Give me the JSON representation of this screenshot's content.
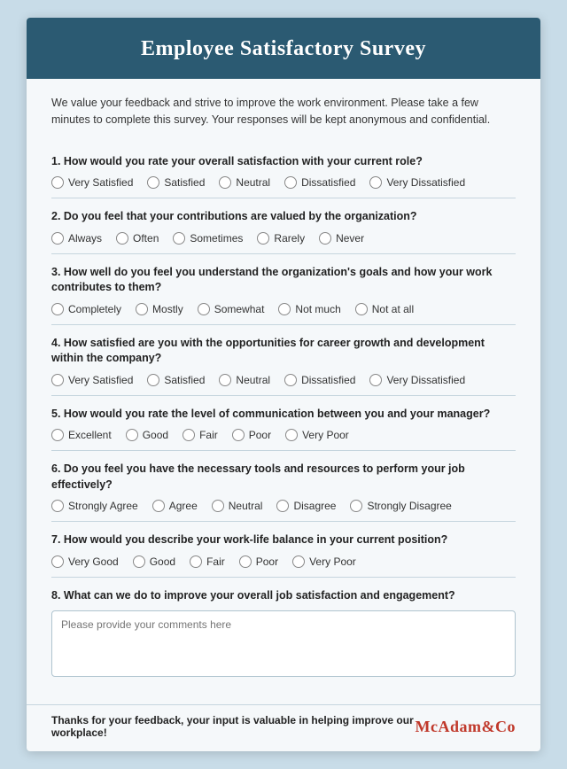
{
  "header": {
    "title": "Employee Satisfactory Survey"
  },
  "intro": "We value your feedback and strive to improve the work environment. Please take a few minutes to complete this survey. Your responses will be kept anonymous and confidential.",
  "questions": [
    {
      "id": "q1",
      "number": "1.",
      "text": "How would you rate your overall satisfaction with your current role?",
      "options": [
        "Very Satisfied",
        "Satisfied",
        "Neutral",
        "Dissatisfied",
        "Very Dissatisfied"
      ]
    },
    {
      "id": "q2",
      "number": "2.",
      "text": "Do you feel that your contributions are valued by the organization?",
      "options": [
        "Always",
        "Often",
        "Sometimes",
        "Rarely",
        "Never"
      ]
    },
    {
      "id": "q3",
      "number": "3.",
      "text": "How well do you feel you understand the organization's goals and how your work contributes to them?",
      "options": [
        "Completely",
        "Mostly",
        "Somewhat",
        "Not much",
        "Not at all"
      ]
    },
    {
      "id": "q4",
      "number": "4.",
      "text": "How satisfied are you with the opportunities for career growth and development within the company?",
      "options": [
        "Very Satisfied",
        "Satisfied",
        "Neutral",
        "Dissatisfied",
        "Very Dissatisfied"
      ]
    },
    {
      "id": "q5",
      "number": "5.",
      "text": "How would you rate the level of communication between you and your manager?",
      "options": [
        "Excellent",
        "Good",
        "Fair",
        "Poor",
        "Very Poor"
      ]
    },
    {
      "id": "q6",
      "number": "6.",
      "text": "Do you feel you have the necessary tools and resources to perform your job effectively?",
      "options": [
        "Strongly Agree",
        "Agree",
        "Neutral",
        "Disagree",
        "Strongly Disagree"
      ]
    },
    {
      "id": "q7",
      "number": "7.",
      "text": "How would you describe your work-life balance in your current position?",
      "options": [
        "Very Good",
        "Good",
        "Fair",
        "Poor",
        "Very Poor"
      ]
    },
    {
      "id": "q8",
      "number": "8.",
      "text": "What can we do to improve your overall job satisfaction and engagement?",
      "textarea_placeholder": "Please provide your comments here"
    }
  ],
  "footer": {
    "thanks_text": "Thanks for your feedback, your input is valuable in helping improve our workplace!",
    "brand_name": "McAdam",
    "brand_suffix": "&Co"
  }
}
